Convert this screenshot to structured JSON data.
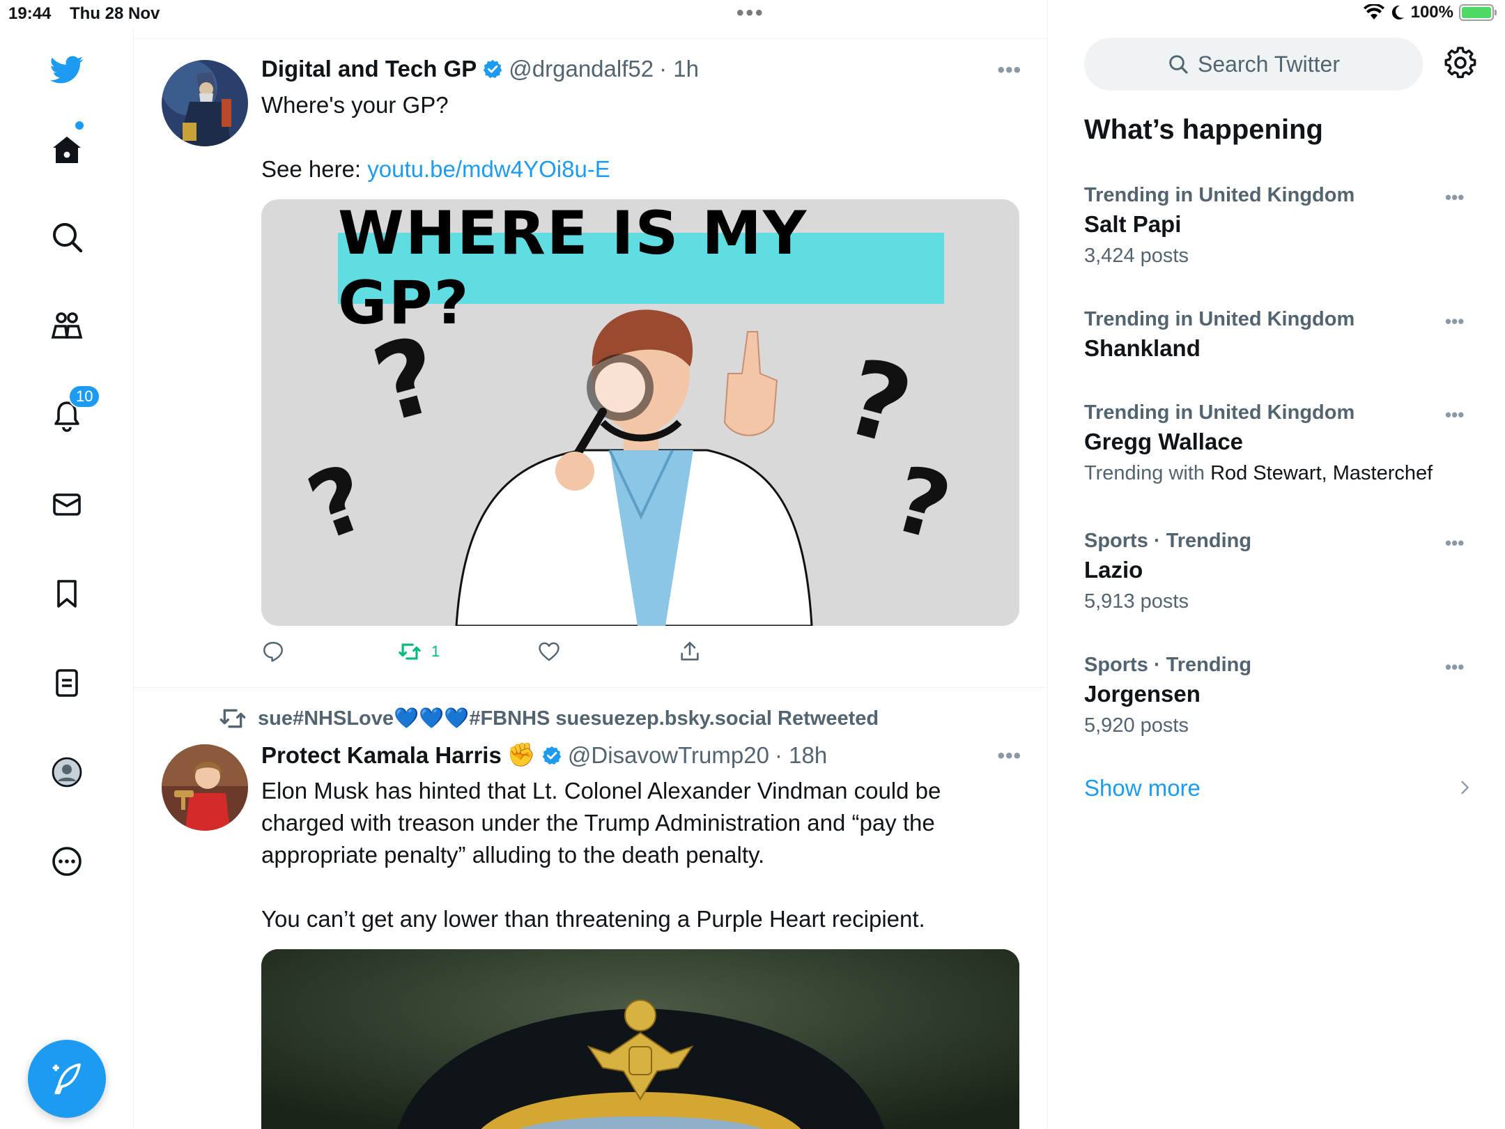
{
  "status_bar": {
    "time": "19:44",
    "date": "Thu 28 Nov",
    "battery": "100%",
    "center_dots": "•••"
  },
  "left_nav": {
    "notifications_badge": "10",
    "icons": [
      "twitter-logo-icon",
      "home-icon",
      "search-icon",
      "communities-icon",
      "notifications-icon",
      "messages-icon",
      "bookmarks-icon",
      "lists-icon",
      "profile-icon",
      "more-icon"
    ],
    "compose_icon": "compose-feather-icon"
  },
  "tweets": [
    {
      "display_name": "Digital and Tech GP",
      "handle": "@drgandalf52",
      "time": "· 1h",
      "more": "•••",
      "text_line1": "Where's your GP?",
      "text_line2_prefix": "See here: ",
      "link": "youtu.be/mdw4YOi8u-E",
      "media_banner": "WHERE IS MY GP?",
      "retweet_count": "1"
    },
    {
      "retweeted_by": "sue#NHSLove💙💙💙#FBNHS suesuezep.bsky.social Retweeted",
      "display_name": "Protect Kamala Harris",
      "name_emoji": "✊",
      "handle": "@DisavowTrump20",
      "time": "· 18h",
      "more": "•••",
      "text_p1": "Elon Musk has hinted that Lt. Colonel Alexander Vindman could be charged with treason under the Trump Administration and “pay the appropriate penalty” alluding to the death penalty.",
      "text_p2": "You can’t get any lower than threatening a Purple Heart recipient."
    }
  ],
  "right": {
    "search_placeholder": "Search Twitter",
    "title": "What’s happening",
    "trends": [
      {
        "context": "Trending in United Kingdom",
        "name": "Salt Papi",
        "meta": "3,424 posts"
      },
      {
        "context": "Trending in United Kingdom",
        "name": "Shankland",
        "meta": ""
      },
      {
        "context": "Trending in United Kingdom",
        "name": "Gregg Wallace",
        "meta_prefix": "Trending with ",
        "meta_with": "Rod Stewart, Masterchef"
      },
      {
        "context": "Sports · Trending",
        "name": "Lazio",
        "meta": "5,913 posts"
      },
      {
        "context": "Sports · Trending",
        "name": "Jorgensen",
        "meta": "5,920 posts"
      }
    ],
    "trend_more": "•••",
    "show_more": "Show more"
  },
  "colors": {
    "accent": "#1d9bf0",
    "text": "#0f1419",
    "secondary": "#536471",
    "retweet_green": "#00ba7c",
    "banner_cyan": "#5fdde3"
  }
}
